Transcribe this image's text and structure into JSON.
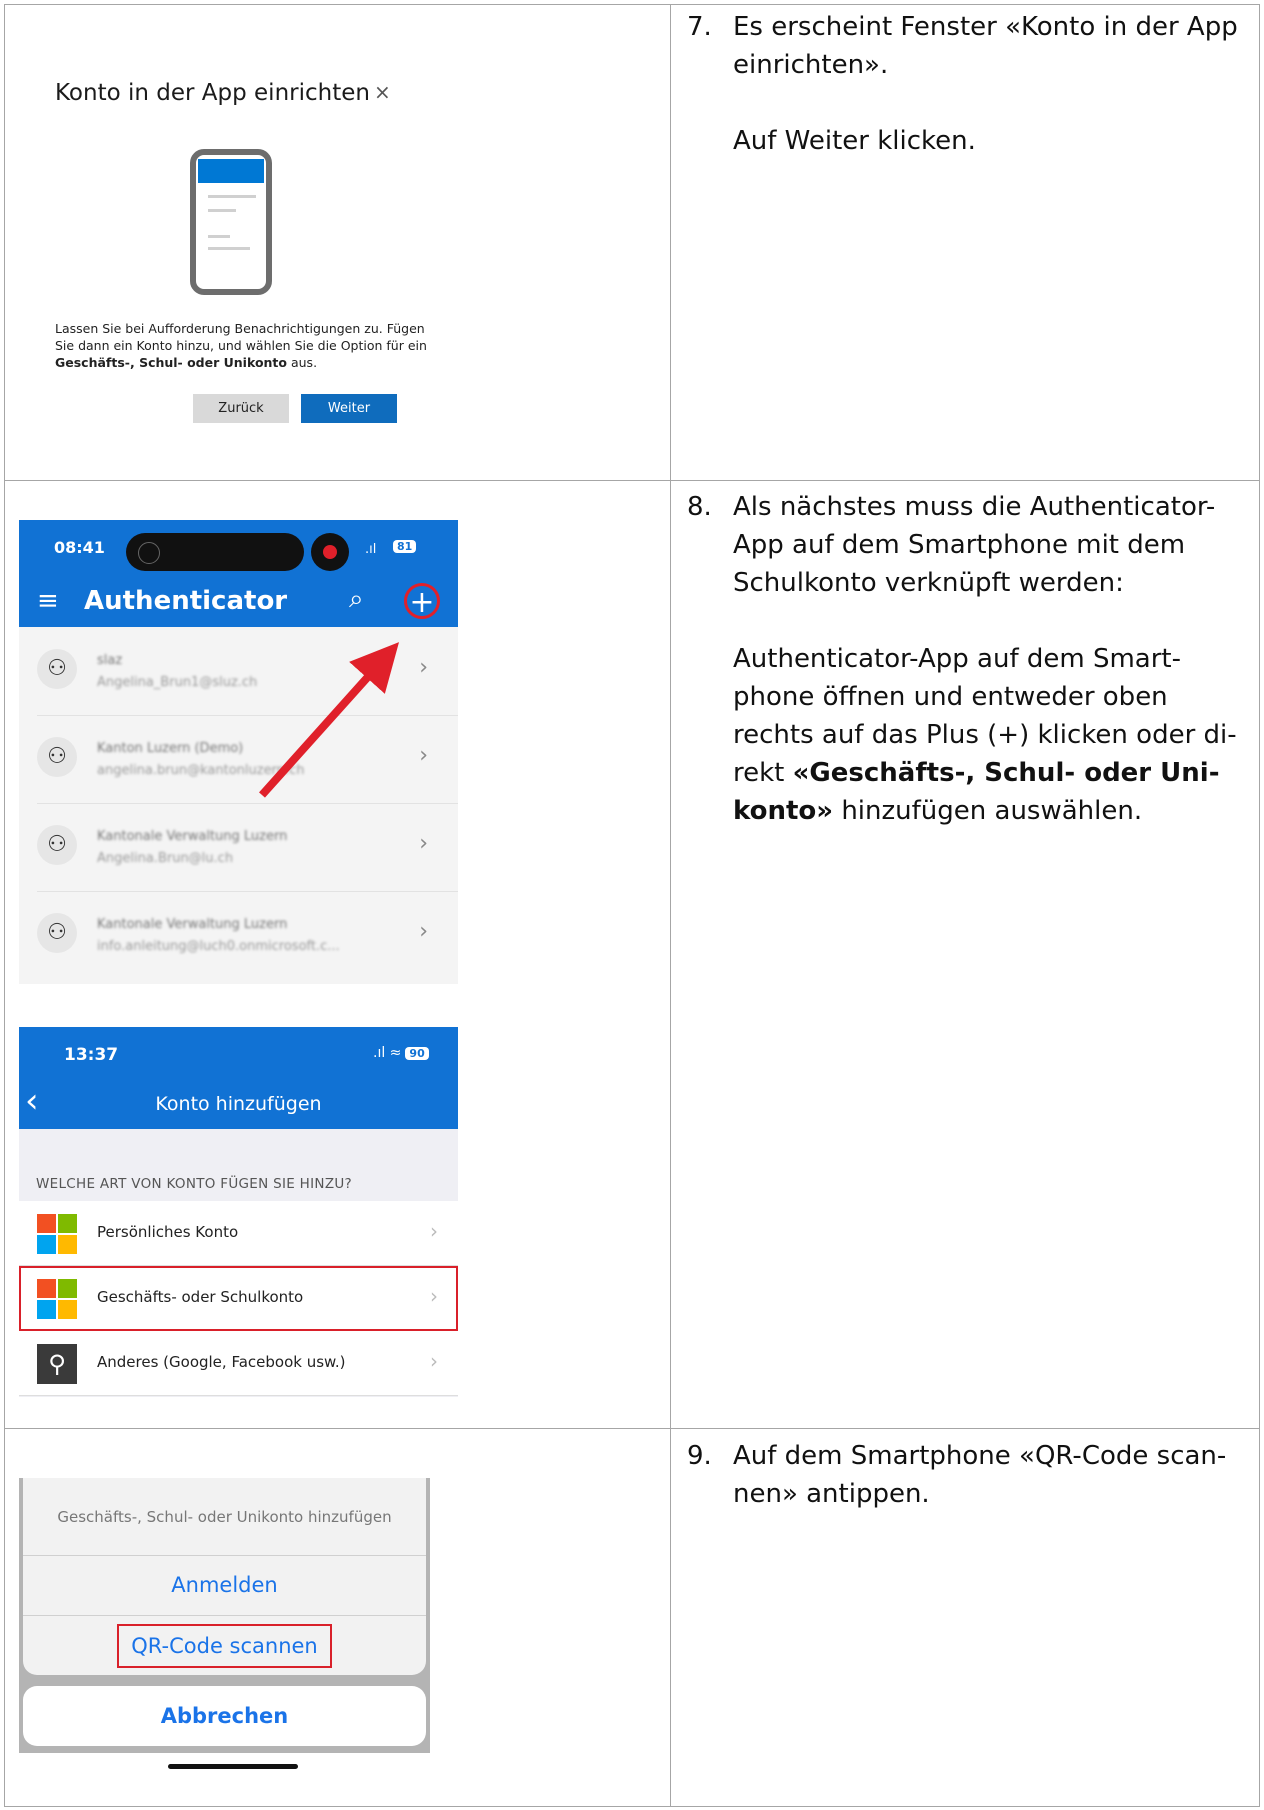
{
  "steps": [
    {
      "number": "7.",
      "paragraphs": [
        "Es erscheint Fenster «Konto in der App einrichten».",
        "Auf Weiter klicken."
      ]
    },
    {
      "number": "8.",
      "p1": "Als nächstes muss die Authenticator-App auf dem Smartphone mit dem Schulkonto verknüpft werden:",
      "p2_pre": "Authenticator-App auf dem Smart-phone öffnen und entweder oben rechts auf das Plus (+) klicken oder di-rekt ",
      "p2_bold": "«Geschäfts-, Schul- oder Uni-konto»",
      "p2_post": " hinzufügen auswählen."
    },
    {
      "number": "9.",
      "paragraphs": [
        "Auf dem Smartphone «QR-Code scan-nen» antippen."
      ]
    }
  ],
  "dialog": {
    "title": "Konto in der App einrichten",
    "close": "×",
    "text_pre": "Lassen Sie bei Aufforderung Benachrichtigungen zu. Fügen Sie dann ein Konto hinzu, und wählen Sie die Option für ein ",
    "text_bold": "Geschäfts-, Schul- oder Unikonto",
    "text_post": " aus.",
    "back_label": "Zurück",
    "next_label": "Weiter"
  },
  "authenticator": {
    "time": "08:41",
    "signal": ".ıl",
    "battery": "81",
    "menu_glyph": "≡",
    "title": "Authenticator",
    "search_glyph": "⌕",
    "add_glyph": "+",
    "accounts": [
      {
        "name": "slaz",
        "email": "Angelina_Brun1@sluz.ch"
      },
      {
        "name": "Kanton Luzern (Demo)",
        "email": "angelina.brun@kantonluzern.ch"
      },
      {
        "name": "Kantonale Verwaltung Luzern",
        "email": "Angelina.Brun@lu.ch"
      },
      {
        "name": "Kantonale Verwaltung Luzern",
        "email": "info.anleitung@luch0.onmicrosoft.c..."
      }
    ],
    "chevron": "›"
  },
  "add_account": {
    "time": "13:37",
    "status": ".ıl ≈",
    "battery": "90",
    "back_glyph": "‹",
    "title": "Konto hinzufügen",
    "section": "WELCHE ART VON KONTO FÜGEN SIE HINZU?",
    "items": [
      "Persönliches Konto",
      "Geschäfts- oder Schulkonto",
      "Anderes (Google, Facebook usw.)"
    ],
    "chevron": "›",
    "colors": {
      "red": "#f25022",
      "green": "#7fba00",
      "blue": "#00a4ef",
      "yellow": "#ffb900",
      "highlight": "#d9202a"
    }
  },
  "action_sheet": {
    "title": "Geschäfts-, Schul- oder Unikonto hinzufügen",
    "sign_in": "Anmelden",
    "scan_qr": "QR-Code scannen",
    "cancel": "Abbrechen"
  }
}
